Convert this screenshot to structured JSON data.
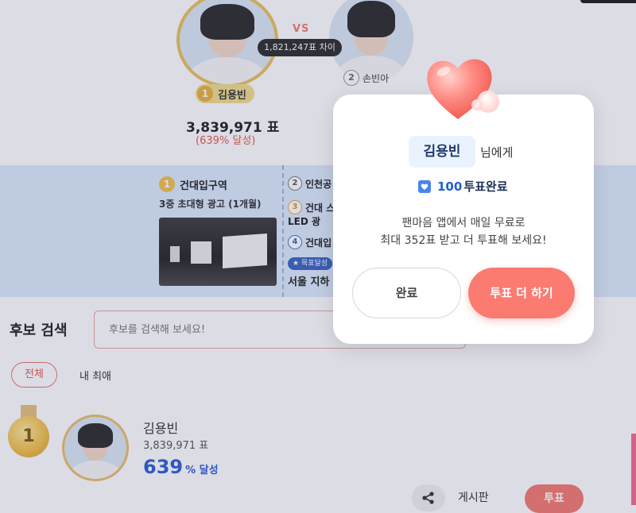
{
  "battle": {
    "vs": "VS",
    "difference": "1,821,247표 차이",
    "first": {
      "rank": "1",
      "name": "김용빈",
      "votes": "3,839,971 표",
      "rate": "(639% 달성)"
    },
    "second": {
      "rank": "2",
      "name": "손빈아"
    }
  },
  "rewards": {
    "first": {
      "rank": "1",
      "title": "건대입구역",
      "desc": "3중 초대형 광고 (1개월)"
    },
    "items": [
      {
        "rank": "2",
        "label": "인천공"
      },
      {
        "rank": "3",
        "label": "건대 스"
      },
      {
        "label": "LED 광"
      },
      {
        "rank": "4",
        "label": "건대입"
      }
    ],
    "goal_tag": "★ 목표달성",
    "subway": "서울 지하"
  },
  "search": {
    "title": "후보 검색",
    "placeholder": "후보를 검색해 보세요!"
  },
  "filters": {
    "all": "전체",
    "mine": "내 최애"
  },
  "candidate": {
    "rank": "1",
    "name": "김용빈",
    "votes": "3,839,971 표",
    "rate_value": "639",
    "rate_suffix": "% 달성"
  },
  "actions": {
    "board": "게시판",
    "vote": "투표"
  },
  "modal": {
    "recipient": "김용빈",
    "recipient_suffix": "님에게",
    "vote_count": "100",
    "vote_done": "투표완료",
    "message_line1": "팬마음 앱에서 매일 무료로",
    "message_line2": "최대 352표 받고 더 투표해 보세요!",
    "done_button": "완료",
    "more_button": "투표 더 하기"
  },
  "colors": {
    "accent_coral": "#fb7b70",
    "accent_blue": "#2f5fd0",
    "gold": "#f2c24a"
  }
}
